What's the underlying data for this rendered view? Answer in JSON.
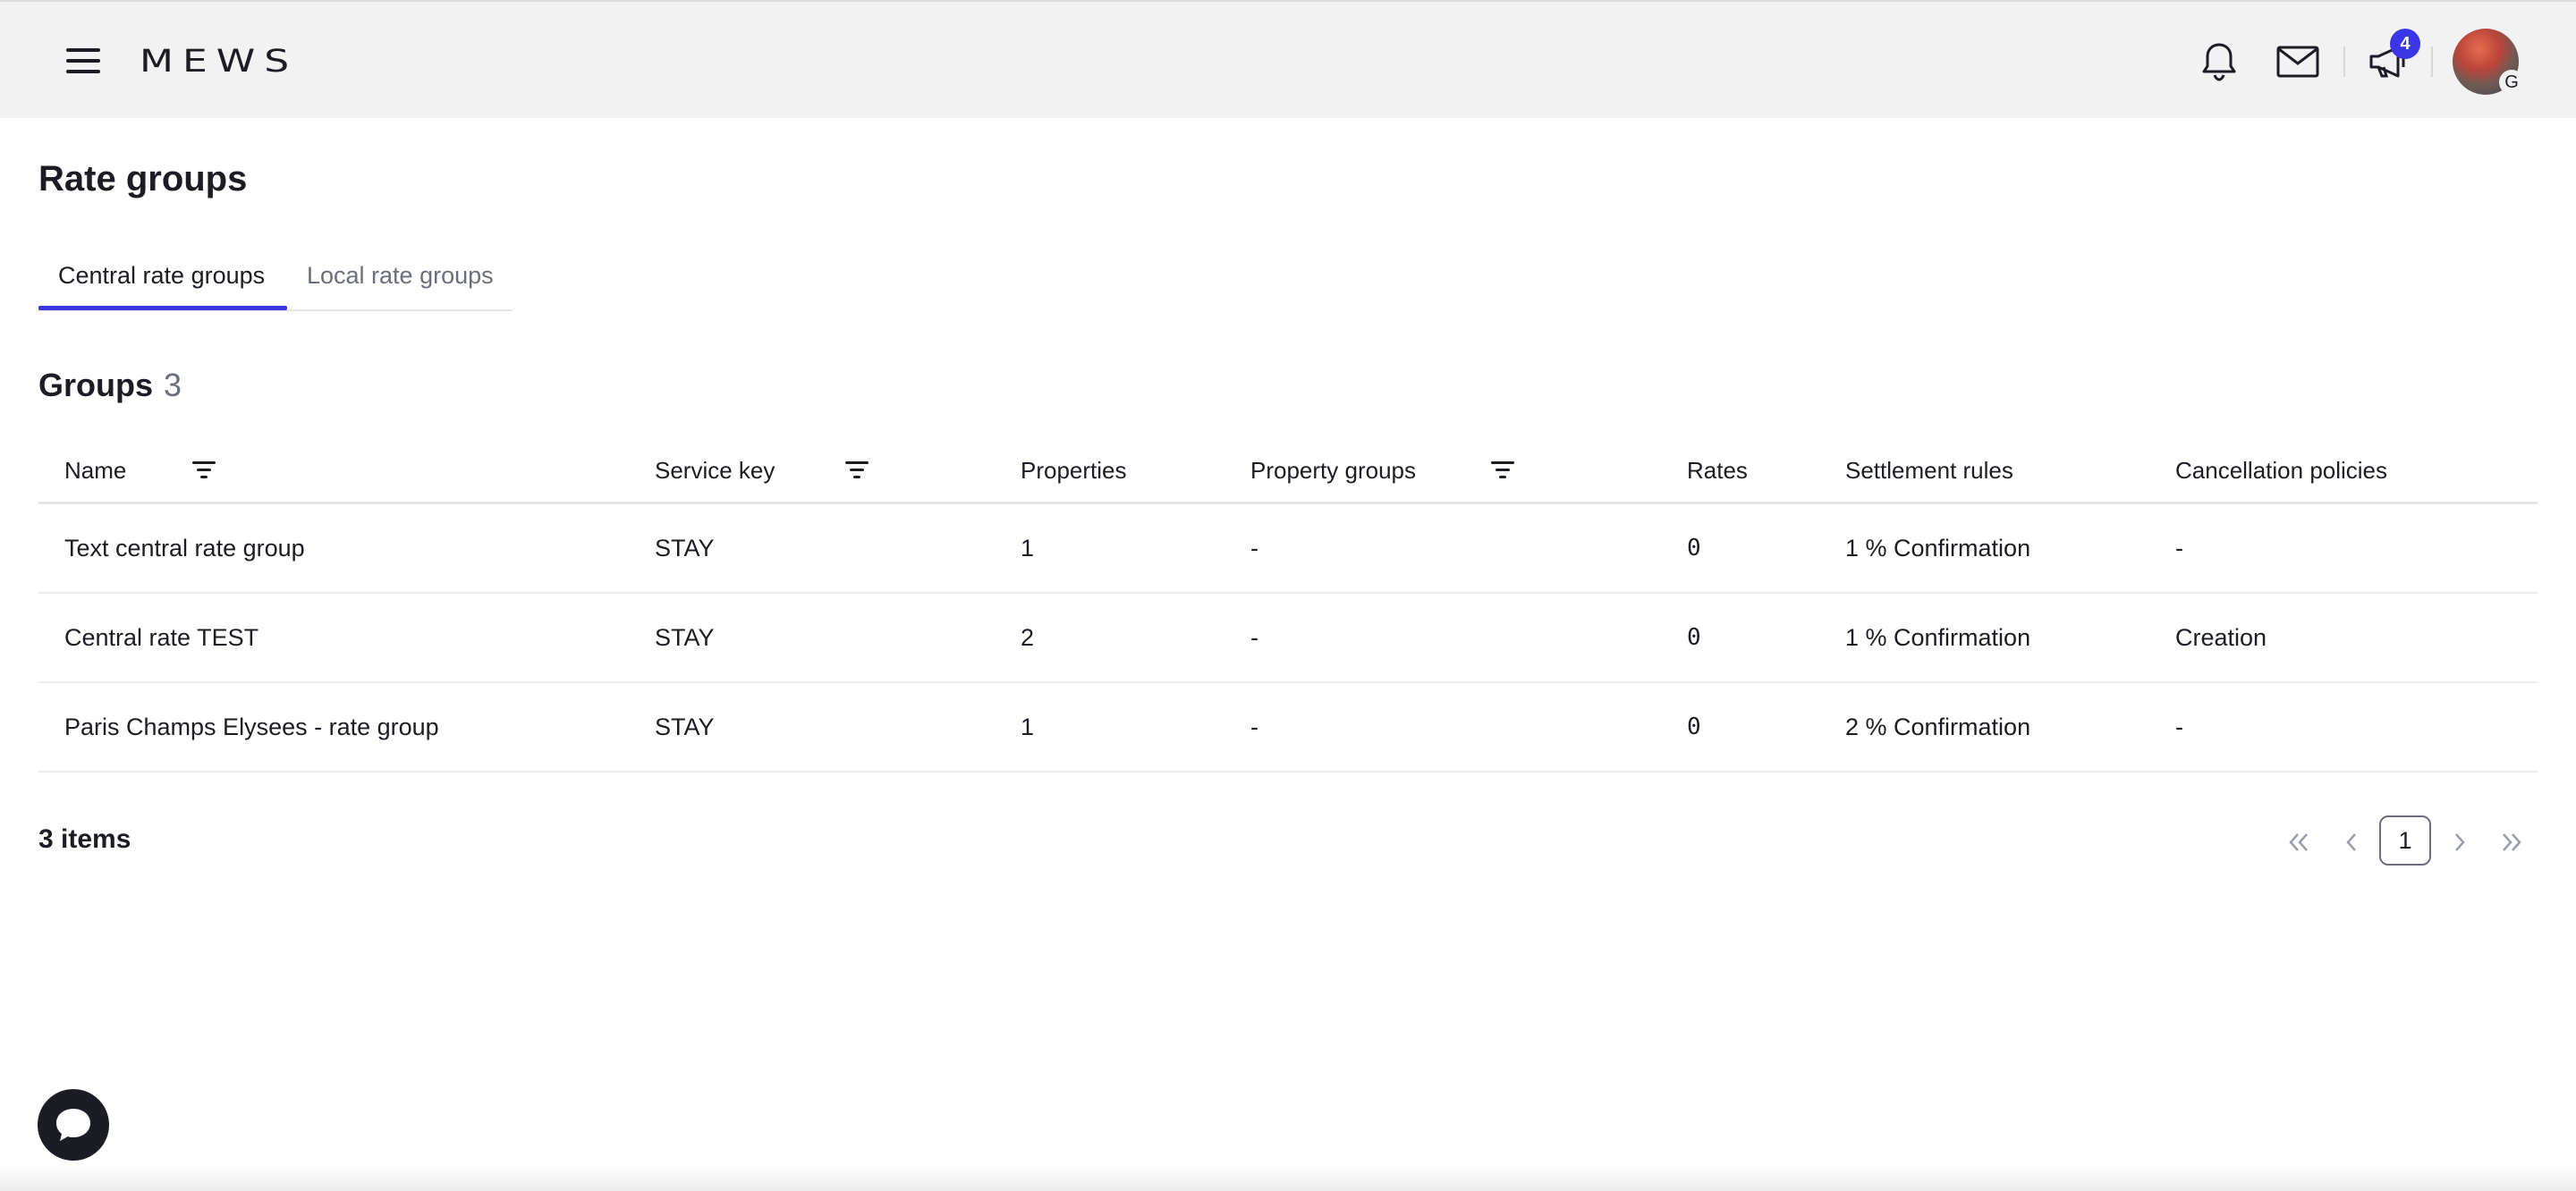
{
  "header": {
    "logo": "MEWS",
    "notifications_badge": "4",
    "user_initial": "G",
    "accent_color": "#3a36e6",
    "icons": [
      "hamburger-icon",
      "bell-icon",
      "mail-icon",
      "megaphone-icon"
    ]
  },
  "page": {
    "title": "Rate groups",
    "tabs": [
      {
        "label": "Central rate groups",
        "active": true
      },
      {
        "label": "Local rate groups",
        "active": false
      }
    ]
  },
  "groups": {
    "title": "Groups",
    "count": "3",
    "columns": [
      "Name",
      "Service key",
      "Properties",
      "Property groups",
      "Rates",
      "Settlement rules",
      "Cancellation policies"
    ],
    "rows": [
      {
        "name": "Text central rate group",
        "service_key": "STAY",
        "properties": "1",
        "property_groups": "-",
        "rates": "0",
        "settlement_rules": "1 % Confirmation",
        "cancellation_policies": "-"
      },
      {
        "name": "Central rate TEST",
        "service_key": "STAY",
        "properties": "2",
        "property_groups": "-",
        "rates": "0",
        "settlement_rules": "1 % Confirmation",
        "cancellation_policies": "Creation"
      },
      {
        "name": "Paris Champs Elysees - rate group",
        "service_key": "STAY",
        "properties": "1",
        "property_groups": "-",
        "rates": "0",
        "settlement_rules": "2 % Confirmation",
        "cancellation_policies": "-"
      }
    ]
  },
  "pagination": {
    "items_label": "3 items",
    "current_page": "1"
  }
}
